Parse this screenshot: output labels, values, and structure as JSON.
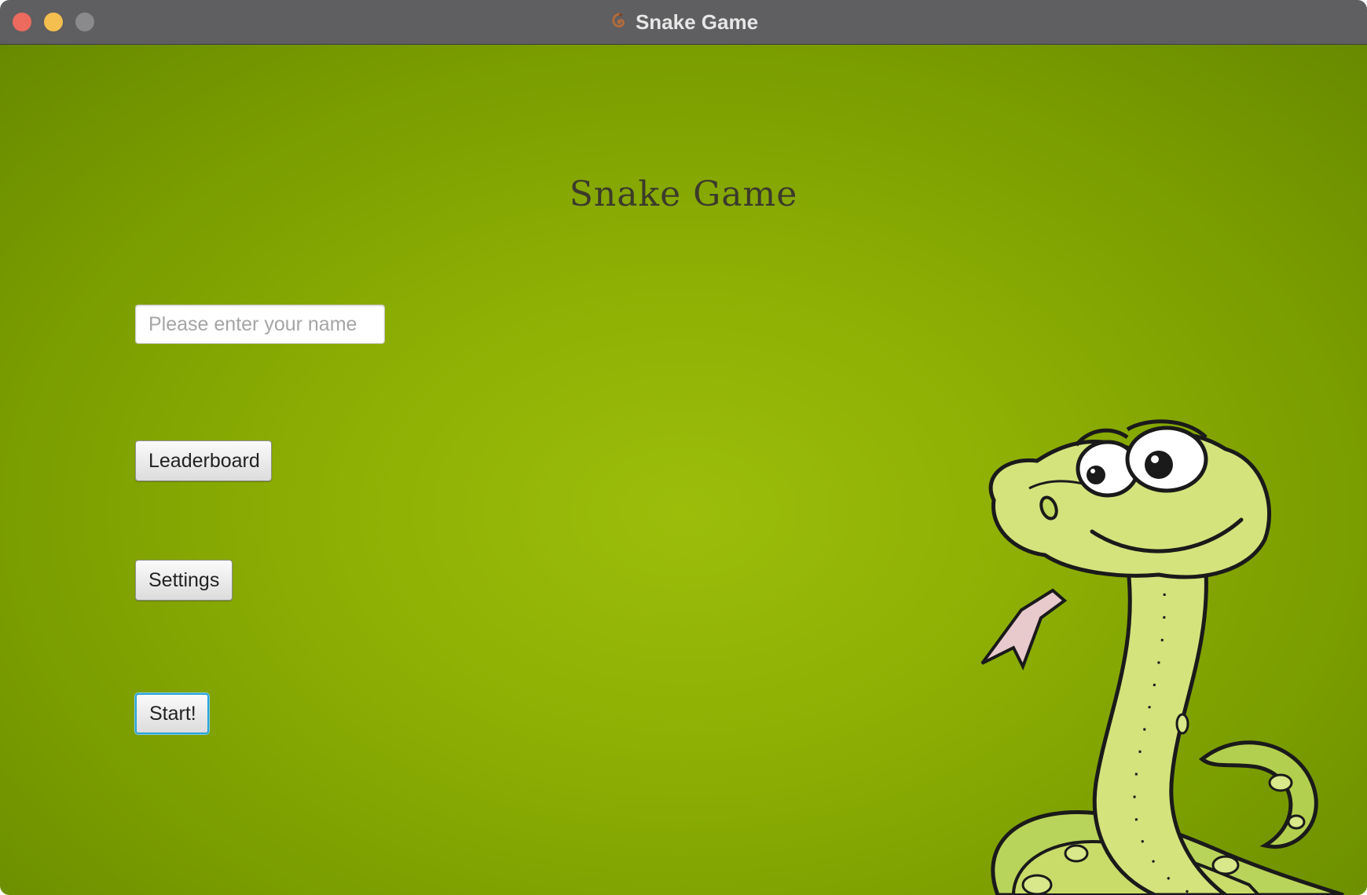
{
  "window": {
    "title": "Snake Game",
    "app_icon": "snake-app-icon"
  },
  "main": {
    "heading": "Snake Game",
    "name_input": {
      "value": "",
      "placeholder": "Please enter your name"
    },
    "buttons": {
      "leaderboard": "Leaderboard",
      "settings": "Settings",
      "start": "Start!"
    }
  },
  "colors": {
    "background": "#8eb004",
    "snake_body": "#c9dc6a",
    "focus_ring": "#2aa3d8"
  }
}
